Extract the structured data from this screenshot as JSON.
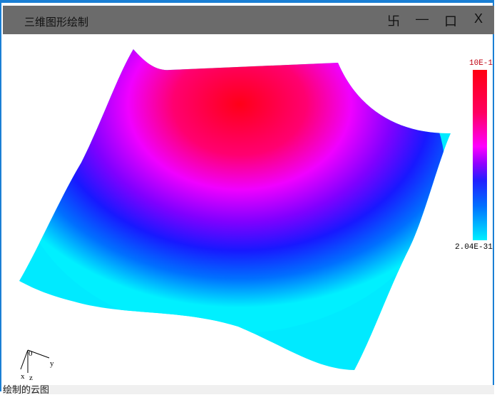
{
  "window": {
    "title": "三维图形绘制",
    "buttons": {
      "pin": "卐",
      "minimize": "—",
      "maximize": "口",
      "close": "X"
    }
  },
  "colorbar": {
    "max_label": "10E-1",
    "min_label": "2.04E-31",
    "colors": [
      "#ff0010",
      "#ff00ff",
      "#2020ff",
      "#00f0ff"
    ]
  },
  "axes": {
    "origin": "0",
    "x": "x",
    "y": "y",
    "z": "z"
  },
  "status": "绘制的云图"
}
